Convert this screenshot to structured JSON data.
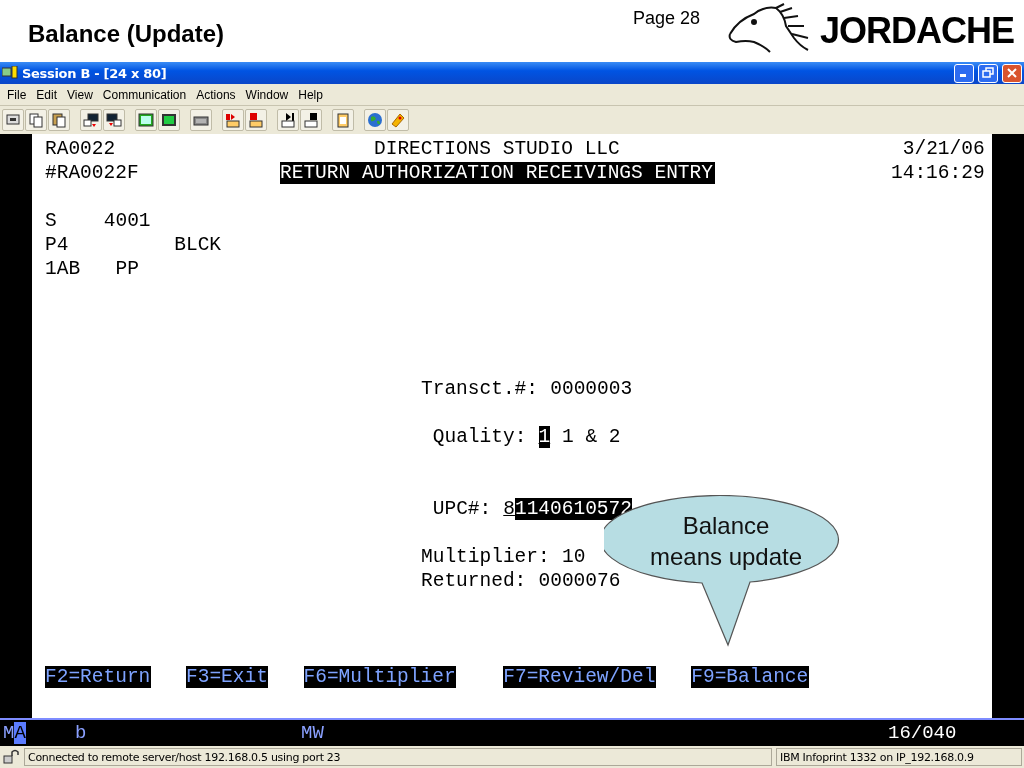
{
  "slide": {
    "title": "Balance (Update)",
    "page": "Page 28",
    "brand": "JORDACHE"
  },
  "window": {
    "title": "Session B - [24 x 80]",
    "menu": [
      "File",
      "Edit",
      "View",
      "Communication",
      "Actions",
      "Window",
      "Help"
    ]
  },
  "terminal": {
    "program": "RA0022",
    "company": "DIRECTIONS STUDIO LLC",
    "date": "3/21/06",
    "format": "#RA0022F",
    "screen_title": "RETURN AUTHORIZATION RECEIVINGS ENTRY",
    "time": "14:16:29",
    "codes": [
      {
        "code": "S",
        "value": "4001"
      },
      {
        "code": "P4",
        "value": "BLCK"
      },
      {
        "code": "1AB",
        "value": "PP"
      }
    ],
    "transaction": {
      "label": "Transct.#:",
      "value": "0000003"
    },
    "quality": {
      "label": "Quality:",
      "value": "1",
      "cursor": false,
      "hint": "1 & 2"
    },
    "upc": {
      "label": "UPC#:",
      "value": "81140610572",
      "cursor": true
    },
    "multiplier": {
      "label": "Multiplier:",
      "value": "10"
    },
    "returned": {
      "label": "Returned:",
      "value": "0000076"
    },
    "function_keys": [
      "F2=Return",
      "F3=Exit",
      "F6=Multiplier",
      "F7=Review/Del",
      "F9=Balance"
    ]
  },
  "callout": {
    "text": "Balance\nmeans update"
  },
  "operator_line": {
    "column_1": "MA",
    "column_2": "b",
    "column_3": "MW",
    "position": "16/040"
  },
  "status_bar": {
    "connection": "Connected to remote server/host 192.168.0.5 using port 23",
    "printer": "IBM Infoprint 1332 on IP_192.168.0.9"
  }
}
